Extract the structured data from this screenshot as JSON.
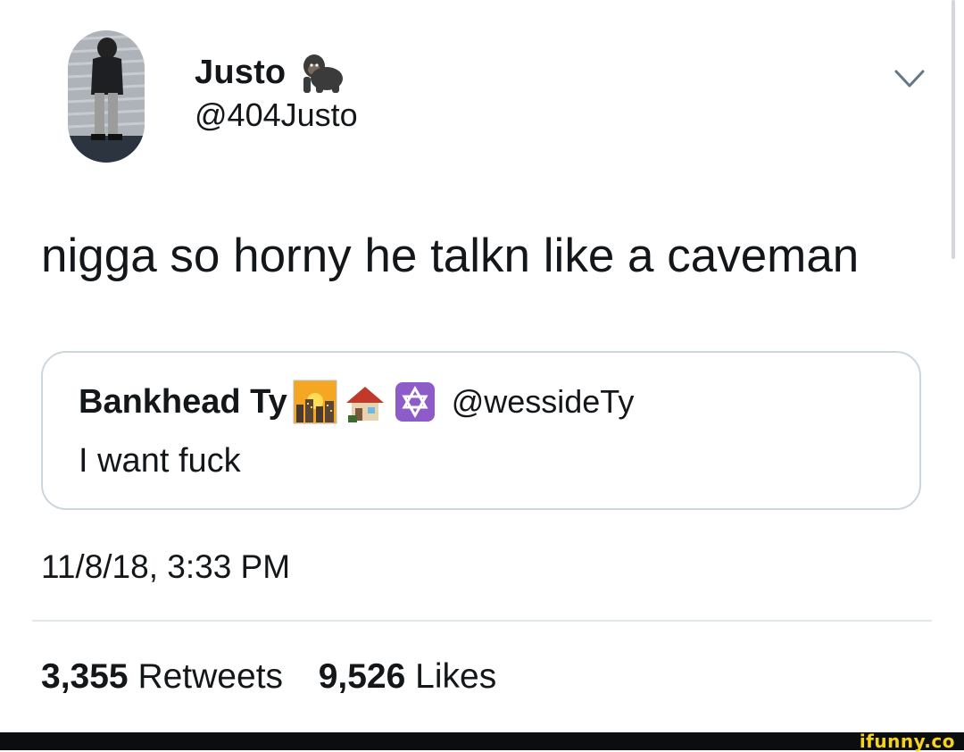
{
  "tweet": {
    "author_name": "Justo",
    "author_handle": "@404Justo",
    "author_emoji": "gorilla-emoji",
    "text": "nigga so horny he talkn like a caveman",
    "timestamp": "11/8/18, 3:33 PM",
    "retweets_count": "3,355",
    "retweets_label": "Retweets",
    "likes_count": "9,526",
    "likes_label": "Likes"
  },
  "quoted_tweet": {
    "author_name": "Bankhead Ty",
    "author_emojis": [
      "city-dusk-emoji",
      "house-emoji",
      "star-of-david-emoji"
    ],
    "author_handle": "@wessideTy",
    "text": "I want fuck"
  },
  "icons": {
    "menu": "chevron-down-icon"
  },
  "colors": {
    "text": "#14171a",
    "border": "#ccd6dd",
    "divider": "#e1e8ed",
    "watermark": "#f7d21e"
  },
  "watermark": "ifunny.co"
}
